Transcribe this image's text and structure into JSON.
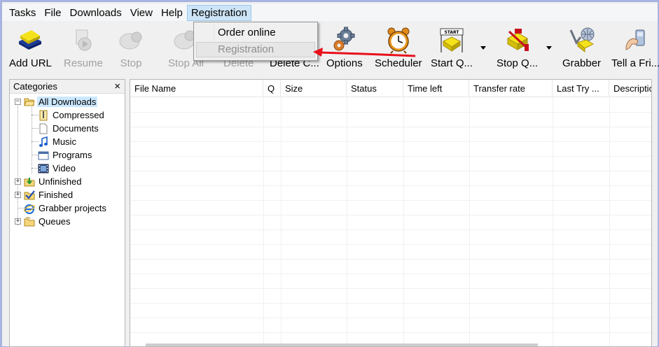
{
  "menubar": {
    "items": [
      "Tasks",
      "Downloads",
      "View",
      "Help",
      "Registration"
    ],
    "file": "File"
  },
  "registration_menu": {
    "items": [
      {
        "label": "Order online",
        "enabled": true
      },
      {
        "label": "Registration",
        "enabled": false
      }
    ]
  },
  "toolbar": {
    "buttons": [
      {
        "label": "Add URL",
        "icon": "add-url-icon",
        "enabled": true
      },
      {
        "label": "Resume",
        "icon": "resume-icon",
        "enabled": false
      },
      {
        "label": "Stop",
        "icon": "stop-icon",
        "enabled": false
      },
      {
        "label": "Stop All",
        "icon": "stop-all-icon",
        "enabled": false
      },
      {
        "label": "Delete",
        "icon": "delete-icon",
        "enabled": false
      },
      {
        "label": "Delete C...",
        "icon": "delete-completed-icon",
        "enabled": true
      },
      {
        "label": "Options",
        "icon": "options-gear-icon",
        "enabled": true
      },
      {
        "label": "Scheduler",
        "icon": "scheduler-alarm-clock-icon",
        "enabled": true
      },
      {
        "label": "Start Q...",
        "icon": "start-queue-icon",
        "enabled": true
      },
      {
        "label": "Stop Q...",
        "icon": "stop-queue-icon",
        "enabled": true
      },
      {
        "label": "Grabber",
        "icon": "grabber-icon",
        "enabled": true
      },
      {
        "label": "Tell a Fri...",
        "icon": "tell-a-friend-icon",
        "enabled": true
      }
    ]
  },
  "categories": {
    "title": "Categories",
    "close": "×",
    "tree": [
      {
        "label": "All Downloads",
        "selected": true
      },
      {
        "label": "Compressed"
      },
      {
        "label": "Documents"
      },
      {
        "label": "Music"
      },
      {
        "label": "Programs"
      },
      {
        "label": "Video"
      },
      {
        "label": "Unfinished"
      },
      {
        "label": "Finished"
      },
      {
        "label": "Grabber projects"
      },
      {
        "label": "Queues"
      }
    ]
  },
  "file_list": {
    "columns": [
      "File Name",
      "Q",
      "Size",
      "Status",
      "Time left",
      "Transfer rate",
      "Last Try ...",
      "Description"
    ]
  },
  "colors": {
    "menu_active": "#cde4f7",
    "selection": "#cce8ff",
    "annotation_arrow": "#e8101a"
  }
}
